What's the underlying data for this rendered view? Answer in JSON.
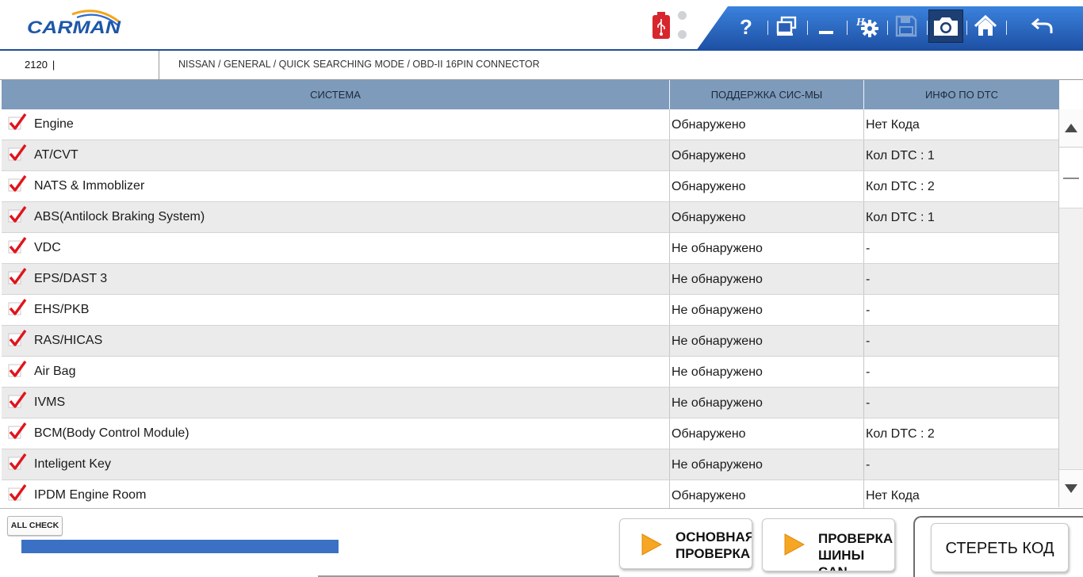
{
  "header": {
    "logo_text": "CARMAN",
    "toolbar": [
      {
        "name": "help-icon",
        "label": "?"
      },
      {
        "name": "windows-icon"
      },
      {
        "name": "minimize-icon"
      },
      {
        "name": "settings-icon",
        "label": "H"
      },
      {
        "name": "save-icon"
      },
      {
        "name": "camera-icon"
      },
      {
        "name": "home-icon"
      },
      {
        "name": "back-icon"
      }
    ],
    "colors": {
      "brand": "#1c4f96",
      "accent": "#2a6ad0",
      "usb": "#d7262c"
    }
  },
  "infobar": {
    "code": "2120",
    "caret": "|",
    "breadcrumb": "NISSAN / GENERAL / QUICK SEARCHING MODE / OBD-II 16PIN CONNECTOR"
  },
  "table": {
    "columns": [
      "СИСТЕМА",
      "ПОДДЕРЖКА СИС-МЫ",
      "ИНФО ПО DTC"
    ],
    "rows": [
      {
        "system": "Engine",
        "support": "Обнаружено",
        "dtc": "Нет Кода",
        "checked": true
      },
      {
        "system": "AT/CVT",
        "support": "Обнаружено",
        "dtc": "Кол DTC : 1",
        "checked": true
      },
      {
        "system": "NATS & Immoblizer",
        "support": "Обнаружено",
        "dtc": "Кол DTC : 2",
        "checked": true
      },
      {
        "system": "ABS(Antilock Braking System)",
        "support": "Обнаружено",
        "dtc": "Кол DTC : 1",
        "checked": true
      },
      {
        "system": "VDC",
        "support": "Не обнаружено",
        "dtc": "-",
        "checked": true
      },
      {
        "system": "EPS/DAST 3",
        "support": "Не обнаружено",
        "dtc": "-",
        "checked": true
      },
      {
        "system": "EHS/PKB",
        "support": "Не обнаружено",
        "dtc": "-",
        "checked": true
      },
      {
        "system": "RAS/HICAS",
        "support": "Не обнаружено",
        "dtc": "-",
        "checked": true
      },
      {
        "system": "Air Bag",
        "support": "Не обнаружено",
        "dtc": "-",
        "checked": true
      },
      {
        "system": "IVMS",
        "support": "Не обнаружено",
        "dtc": "-",
        "checked": true
      },
      {
        "system": "BCM(Body Control Module)",
        "support": "Обнаружено",
        "dtc": "Кол DTC : 2",
        "checked": true
      },
      {
        "system": "Inteligent Key",
        "support": "Не обнаружено",
        "dtc": "-",
        "checked": true
      },
      {
        "system": "IPDM Engine Room",
        "support": "Обнаружено",
        "dtc": "Нет Кода",
        "checked": true
      }
    ]
  },
  "footer": {
    "all_check": "ALL CHECK",
    "progress": 1.0,
    "btn_basic": "ОСНОВНАЯ\nПРОВЕРКА",
    "btn_can": "ПРОВЕРКА\nШИНЫ\nCAN",
    "btn_erase": "СТЕРЕТЬ КОД"
  }
}
